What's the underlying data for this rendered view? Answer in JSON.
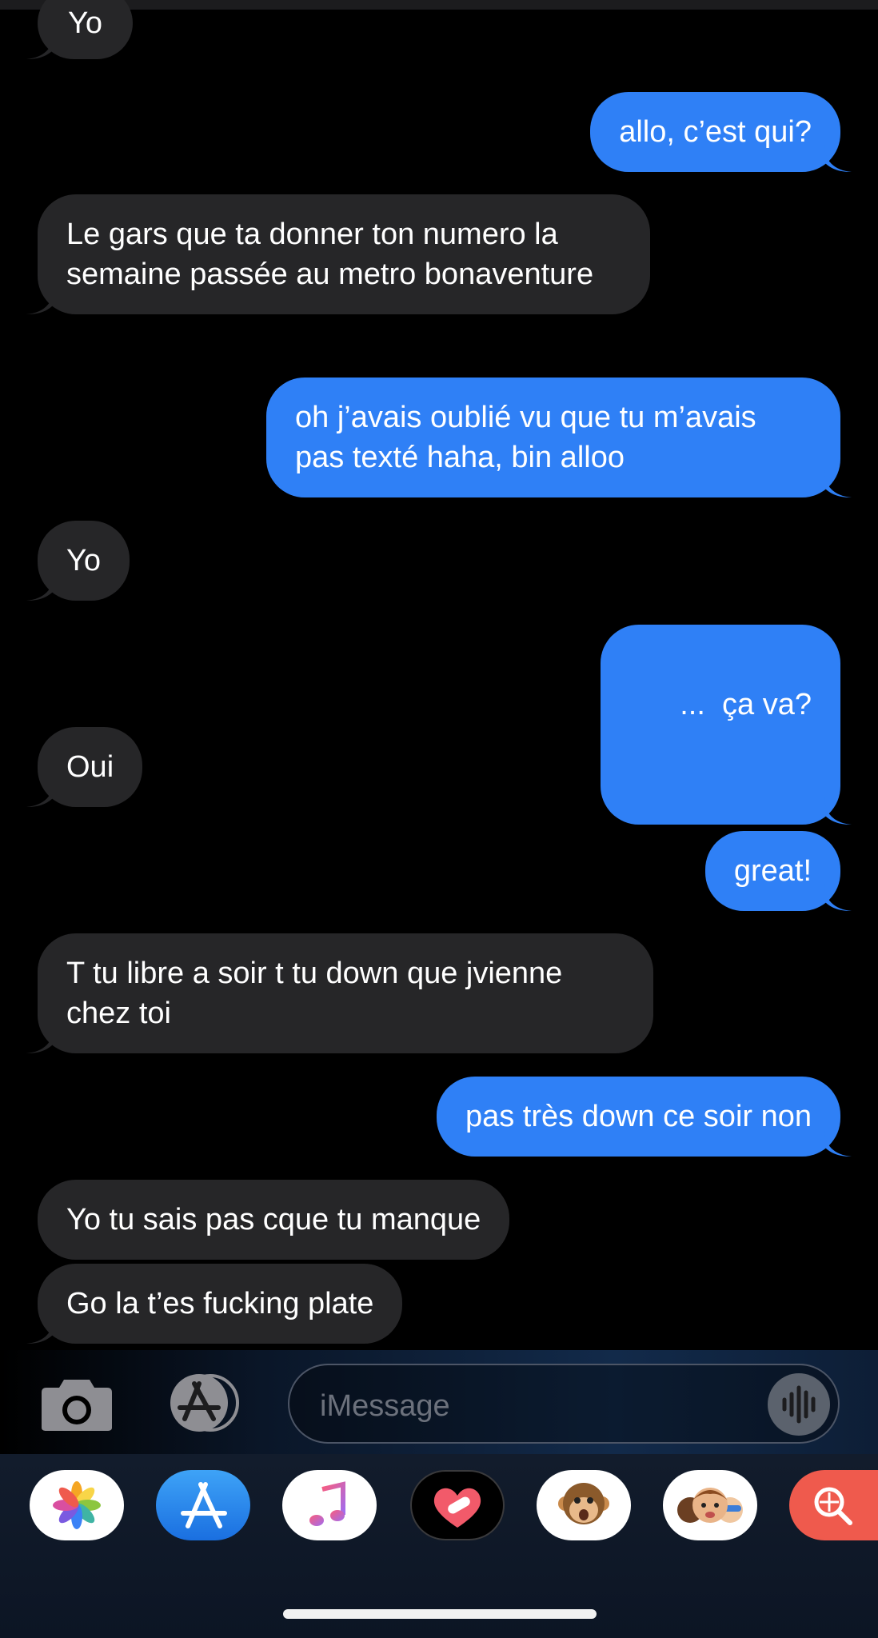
{
  "conversation": {
    "messages": [
      {
        "from": "them",
        "text": "Yo"
      },
      {
        "from": "me",
        "text": "allo, c’est qui?"
      },
      {
        "from": "them",
        "text": "Le gars que ta donner ton numero la semaine passée au metro bonaventure"
      },
      {
        "from": "me",
        "text": "oh j’avais oublié vu que tu m’avais pas texté haha, bin alloo"
      },
      {
        "from": "them",
        "text": "Yo"
      },
      {
        "from": "me",
        "text": "...  ça va?"
      },
      {
        "from": "them",
        "text": "Oui"
      },
      {
        "from": "me",
        "text": "great!"
      },
      {
        "from": "them",
        "text": "T tu libre a soir t tu down que jvienne chez toi"
      },
      {
        "from": "me",
        "text": "pas très down ce soir non"
      },
      {
        "from": "them",
        "text": "Yo tu sais pas cque tu manque"
      },
      {
        "from": "them",
        "text": "Go la t’es fucking plate"
      }
    ]
  },
  "composer": {
    "placeholder": "iMessage",
    "camera_icon": "camera-icon",
    "apps_icon": "app-store-icon",
    "audio_icon": "audio-waveform-icon"
  },
  "app_drawer": {
    "apps": [
      {
        "name": "photos-app-icon"
      },
      {
        "name": "app-store-app-icon"
      },
      {
        "name": "music-app-icon"
      },
      {
        "name": "digital-touch-app-icon"
      },
      {
        "name": "animoji-app-icon"
      },
      {
        "name": "memoji-app-icon"
      },
      {
        "name": "image-search-app-icon"
      }
    ]
  },
  "colors": {
    "sent_bubble": "#2f80f6",
    "received_bubble": "#262628",
    "background": "#000000"
  }
}
